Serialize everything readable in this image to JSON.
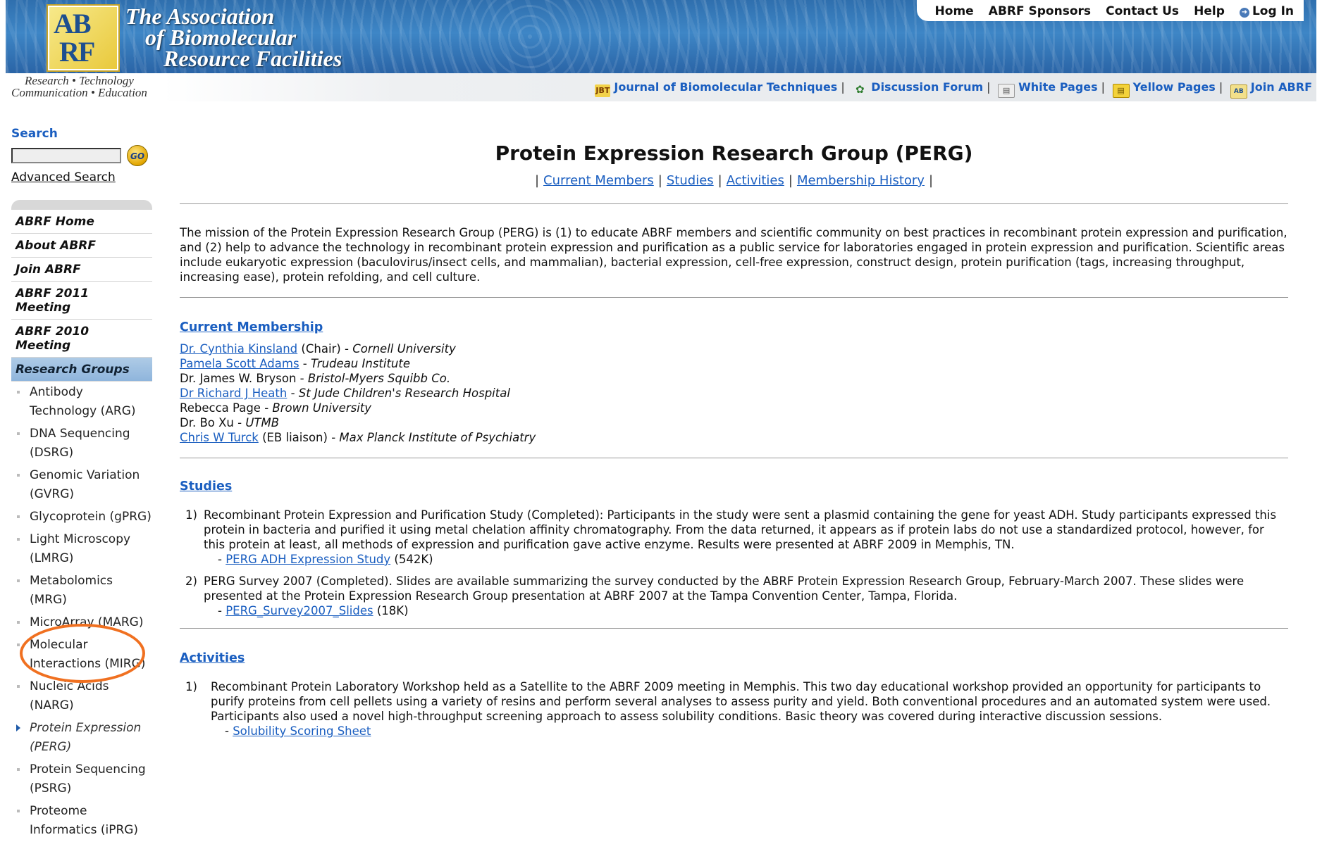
{
  "header": {
    "logo_letters": [
      "AB",
      "RF"
    ],
    "org_title_lines": [
      "The Association",
      "of Biomolecular",
      "Resource Facilities"
    ],
    "tagline_lines": [
      "Research • Technology",
      "Communication • Education"
    ],
    "top_nav": [
      "Home",
      "ABRF Sponsors",
      "Contact Us",
      "Help",
      "Log In"
    ],
    "tool_links": [
      {
        "icon": "jbt-icon",
        "label": "Journal of Biomolecular Techniques"
      },
      {
        "icon": "discussion-icon",
        "label": "Discussion Forum"
      },
      {
        "icon": "white-pages-icon",
        "label": "White Pages"
      },
      {
        "icon": "yellow-pages-icon",
        "label": "Yellow Pages"
      },
      {
        "icon": "abrf-icon",
        "label": "Join ABRF"
      }
    ]
  },
  "sidebar": {
    "search_label": "Search",
    "go_label": "GO",
    "advanced_search": "Advanced Search",
    "nav": [
      "ABRF Home",
      "About ABRF",
      "Join ABRF",
      "ABRF 2011 Meeting",
      "ABRF 2010 Meeting",
      "Research Groups"
    ],
    "groups": [
      "Antibody Technology (ARG)",
      "DNA Sequencing (DSRG)",
      "Genomic Variation (GVRG)",
      "Glycoprotein (gPRG)",
      "Light Microscopy (LMRG)",
      "Metabolomics (MRG)",
      "MicroArray (MARG)",
      "Molecular Interactions (MIRG)",
      "Nucleic Acids (NARG)",
      "Protein Expression (PERG)",
      "Protein Sequencing (PSRG)",
      "Proteome Informatics (iPRG)"
    ]
  },
  "main": {
    "title": "Protein Expression Research Group (PERG)",
    "page_nav": [
      "Current Members",
      "Studies",
      "Activities",
      "Membership History"
    ],
    "mission": "The mission of the Protein Expression Research Group (PERG) is (1) to educate ABRF members and scientific community on best practices in recombinant protein expression and purification, and (2) help to advance the technology in recombinant protein expression and purification as a public service for laboratories engaged in protein expression and purification. Scientific areas include eukaryotic expression (baculovirus/insect cells, and mammalian), bacterial expression, cell-free expression, construct design, protein purification (tags, increasing throughput, increasing ease), protein refolding, and cell culture.",
    "membership_heading": "Current Membership",
    "members": [
      {
        "name": "Dr. Cynthia Kinsland",
        "role": " (Chair) - ",
        "inst": "Cornell University"
      },
      {
        "name": "Pamela Scott Adams",
        "role": " - ",
        "inst": "Trudeau Institute"
      },
      {
        "name": "Dr. James W. Bryson",
        "role": " - ",
        "inst": "Bristol-Myers Squibb Co."
      },
      {
        "name": "Dr Richard J Heath",
        "role": " - ",
        "inst": "St Jude Children's Research Hospital"
      },
      {
        "name": "Rebecca Page",
        "role": " - ",
        "inst": "Brown University"
      },
      {
        "name": "Dr. Bo Xu",
        "role": " - ",
        "inst": "UTMB"
      },
      {
        "name": "Chris W Turck",
        "role": " (EB liaison) - ",
        "inst": "Max Planck Institute of Psychiatry"
      }
    ],
    "studies_heading": "Studies",
    "studies": [
      {
        "num": "1)",
        "text": "Recombinant Protein Expression and Purification Study (Completed): Participants in the study were sent a plasmid containing the gene for yeast ADH. Study participants expressed this protein in bacteria and purified it using metal chelation affinity chromatography. From the data returned, it appears as if protein labs do not use a standardized protocol, however, for this protein at least, all methods of expression and purification gave active enzyme. Results were presented at ABRF 2009 in Memphis, TN.",
        "file": "PERG ADH Expression Study",
        "size": "(542K)"
      },
      {
        "num": "2)",
        "text": "PERG Survey 2007 (Completed). Slides are available summarizing the survey conducted by the ABRF Protein Expression Research Group, February-March 2007. These slides were presented at the Protein Expression Research Group presentation at ABRF 2007 at the Tampa Convention Center, Tampa, Florida.",
        "file": "PERG_Survey2007_Slides",
        "size": "(18K)"
      }
    ],
    "activities_heading": "Activities",
    "activities": [
      {
        "num": "1)",
        "text": "Recombinant Protein Laboratory Workshop held as a Satellite to the ABRF 2009 meeting in Memphis. This two day educational workshop provided an opportunity for participants to purify proteins from cell pellets using a variety of resins and perform several analyses to assess purity and yield. Both conventional procedures and an automated system were used. Participants also used a novel high-throughput screening approach to assess solubility conditions. Basic theory was covered during interactive discussion sessions.",
        "file": "Solubility Scoring Sheet"
      }
    ]
  },
  "colors": {
    "link": "#1a5ec0",
    "banner": "#3e86c6",
    "highlight_circle": "#f07020",
    "active_nav": "#9fc0e2"
  }
}
